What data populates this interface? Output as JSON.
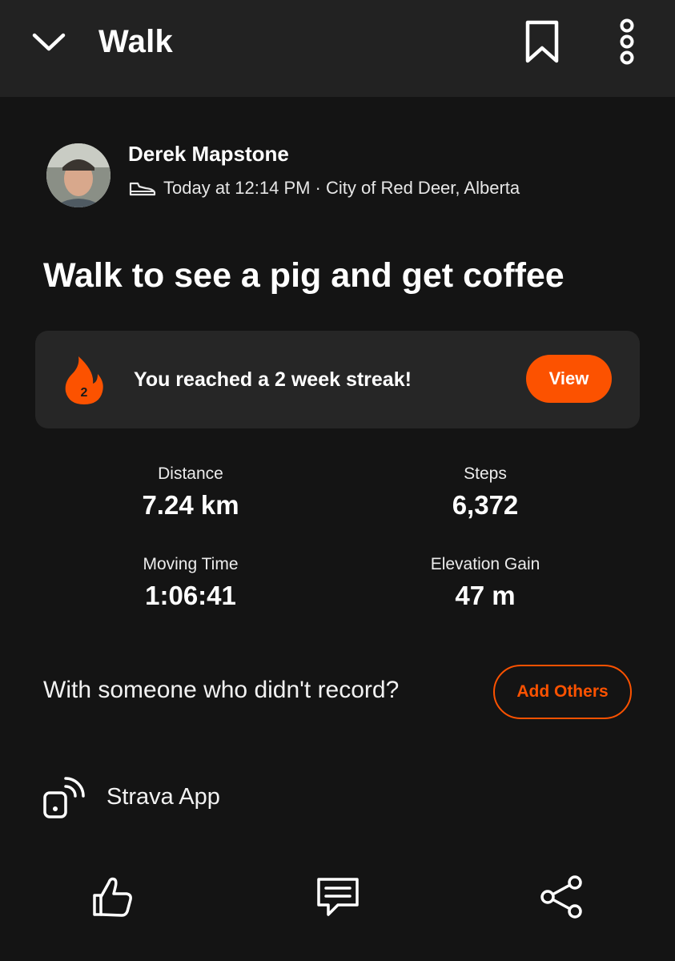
{
  "header": {
    "title": "Walk",
    "icons": [
      "chevron-down-icon",
      "bookmark-icon",
      "more-vertical-icon"
    ]
  },
  "athlete": {
    "name": "Derek Mapstone",
    "meta": "Today at 12:14 PM · City of Red Deer, Alberta",
    "activity_icon": "shoe-icon"
  },
  "activity": {
    "title": "Walk to see a pig and get coffee"
  },
  "streak": {
    "count": "2",
    "message": "You reached a 2 week streak!",
    "button_label": "View"
  },
  "stats": [
    {
      "label": "Distance",
      "value": "7.24 km"
    },
    {
      "label": "Steps",
      "value": "6,372"
    },
    {
      "label": "Moving Time",
      "value": "1:06:41"
    },
    {
      "label": "Elevation Gain",
      "value": "47 m"
    }
  ],
  "add_others": {
    "prompt": "With someone who didn't record?",
    "button_label": "Add Others"
  },
  "device": {
    "name": "Strava App",
    "icon": "device-signal-icon"
  },
  "actions": [
    "kudos-thumbs-up-icon",
    "comment-icon",
    "share-icon"
  ],
  "colors": {
    "accent": "#fc5200",
    "background": "#141414",
    "header_bg": "#222222",
    "card_bg": "#262626"
  }
}
